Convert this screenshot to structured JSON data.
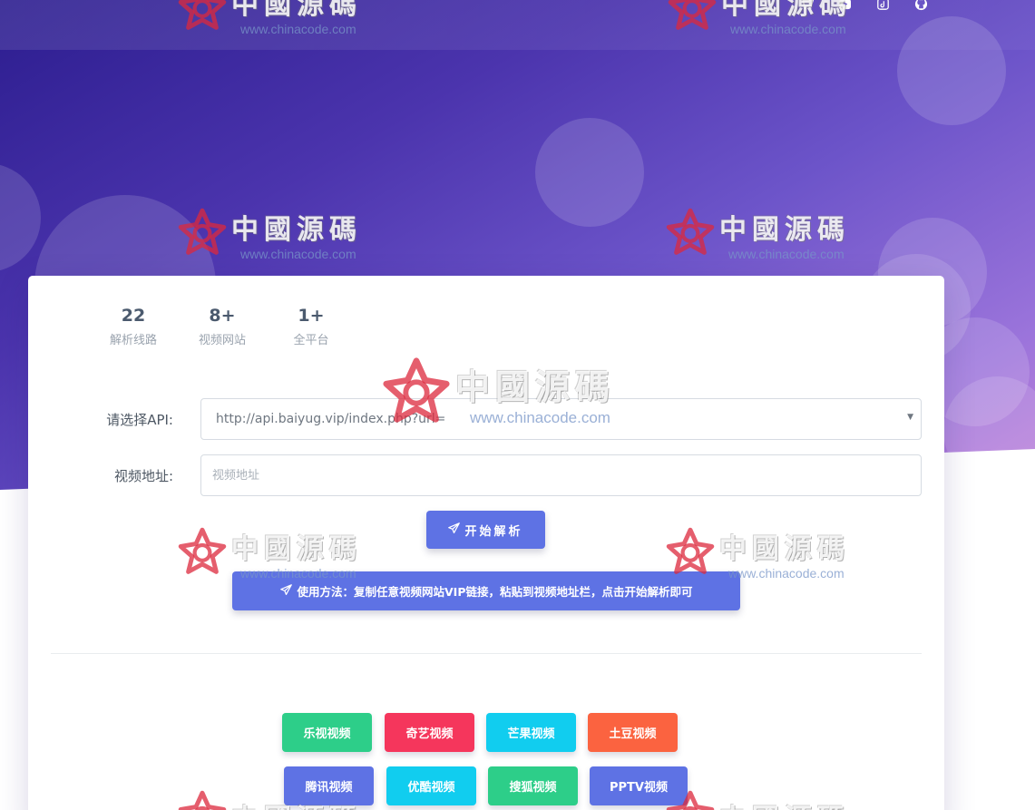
{
  "nav": {
    "icons": [
      "cart-icon",
      "youtube-icon",
      "tiktok-icon",
      "github-icon"
    ]
  },
  "stats": [
    {
      "value": "22",
      "label": "解析线路"
    },
    {
      "value": "8+",
      "label": "视频网站"
    },
    {
      "value": "1+",
      "label": "全平台"
    }
  ],
  "form": {
    "api_label": "请选择API:",
    "api_selected": "http://api.baiyug.vip/index.php?url=",
    "url_label": "视频地址:",
    "url_placeholder": "视频地址",
    "url_value": ""
  },
  "start_button": "开始解析",
  "usage_text": "使用方法：复制任意视频网站VIP链接，粘贴到视频地址栏，点击开始解析即可",
  "sites": [
    {
      "label": "乐视视频",
      "color": "#2dce89"
    },
    {
      "label": "奇艺视频",
      "color": "#f5365c"
    },
    {
      "label": "芒果视频",
      "color": "#11cdef"
    },
    {
      "label": "土豆视频",
      "color": "#fb6340"
    },
    {
      "label": "腾讯视频",
      "color": "#5e72e4"
    },
    {
      "label": "优酷视频",
      "color": "#11cdef"
    },
    {
      "label": "搜狐视频",
      "color": "#2dce89"
    },
    {
      "label": "PPTV视频",
      "color": "#5e72e4"
    }
  ],
  "watermark": {
    "cn": "中國源碼",
    "url": "www.chinacode.com"
  },
  "colors": {
    "primary": "#5e72e4",
    "hero_start": "#2c1d8f",
    "hero_end": "#cf86d8"
  }
}
